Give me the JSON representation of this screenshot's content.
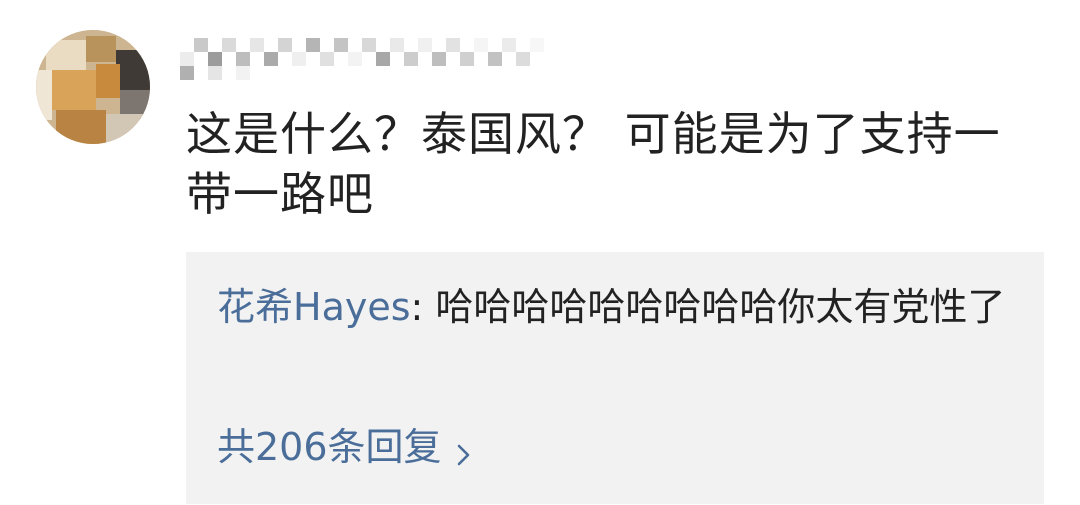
{
  "comment": {
    "username": "",
    "text": "这是什么？泰国风？ 可能是为了支持一带一路吧"
  },
  "replies": [
    {
      "author": "花希Hayes",
      "separator": ": ",
      "text": "哈哈哈哈哈哈哈哈哈你太有党性了"
    }
  ],
  "more_replies": {
    "label": "共206条回复",
    "icon": "chevron-right-icon"
  },
  "colors": {
    "text": "#222222",
    "link": "#4a6e99",
    "reply_bg": "#f2f2f2"
  }
}
